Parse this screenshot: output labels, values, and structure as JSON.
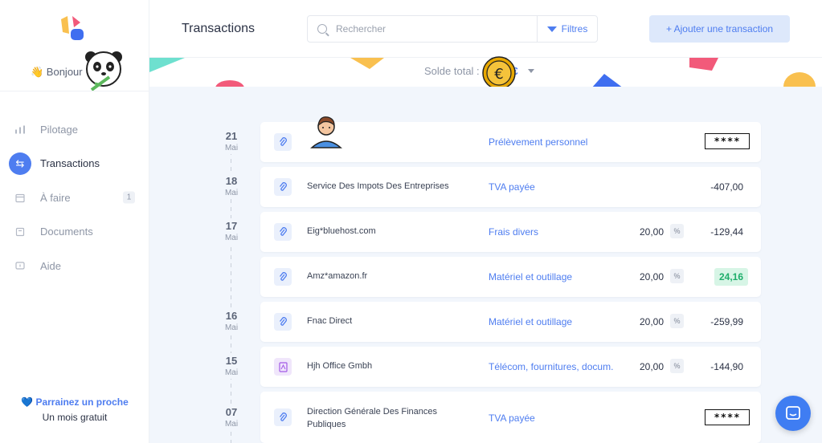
{
  "sidebar": {
    "greeting": "👋 Bonjour",
    "items": [
      {
        "label": "Pilotage",
        "icon": "bar-chart-icon",
        "active": false
      },
      {
        "label": "Transactions",
        "icon": "swap-icon",
        "active": true
      },
      {
        "label": "À faire",
        "icon": "calendar-icon",
        "active": false,
        "badge": "1"
      },
      {
        "label": "Documents",
        "icon": "folder-icon",
        "active": false
      },
      {
        "label": "Aide",
        "icon": "chat-bubble-icon",
        "active": false
      }
    ],
    "referral": {
      "title": "💙 Parrainez un proche",
      "subtitle": "Un mois gratuit"
    }
  },
  "header": {
    "title": "Transactions",
    "search_placeholder": "Rechercher",
    "filters_label": "Filtres",
    "add_label": "+ Ajouter une transaction"
  },
  "balance": {
    "label": "Solde total :",
    "amount": "9 €"
  },
  "dates": [
    {
      "day": "21",
      "month": "Mai"
    },
    {
      "day": "18",
      "month": "Mai"
    },
    {
      "day": "17",
      "month": "Mai"
    },
    {
      "day": "16",
      "month": "Mai"
    },
    {
      "day": "15",
      "month": "Mai"
    },
    {
      "day": "07",
      "month": "Mai"
    }
  ],
  "transactions": [
    {
      "label": "",
      "category": "Prélèvement personnel",
      "vat": "",
      "amount": "****",
      "masked": true
    },
    {
      "label": "Service Des Impots Des Entreprises",
      "category": "TVA payée",
      "vat": "",
      "amount": "-407,00"
    },
    {
      "label": "Eig*bluehost.com",
      "category": "Frais divers",
      "vat": "20,00",
      "pct": "%",
      "amount": "-129,44"
    },
    {
      "label": "Amz*amazon.fr",
      "category": "Matériel et outillage",
      "vat": "20,00",
      "pct": "%",
      "amount": "24,16",
      "positive": true
    },
    {
      "label": "Fnac Direct",
      "category": "Matériel et outillage",
      "vat": "20,00",
      "pct": "%",
      "amount": "-259,99"
    },
    {
      "label": "Hjh Office Gmbh",
      "category": "Télécom, fournitures, docum.",
      "vat": "20,00",
      "pct": "%",
      "amount": "-144,90"
    },
    {
      "label": "Direction Générale Des Finances Publiques",
      "category": "TVA payée",
      "vat": "",
      "amount": "****",
      "masked": true
    }
  ],
  "colors": {
    "accent": "#4e7df0",
    "positive": "#1fae6b",
    "background": "#f2f6fc"
  }
}
